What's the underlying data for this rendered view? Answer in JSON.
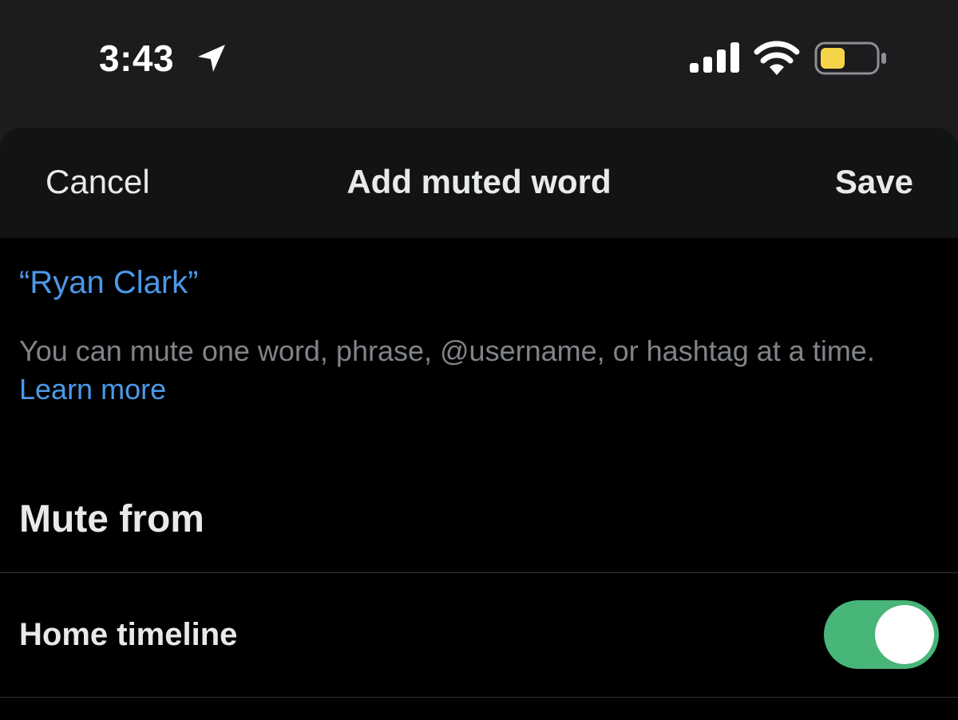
{
  "status_bar": {
    "time": "3:43",
    "location_icon": "location-arrow-icon",
    "signal_icon": "cellular-signal-icon",
    "wifi_icon": "wifi-icon",
    "battery_icon": "battery-low-power-icon",
    "battery_color": "#f5d547"
  },
  "sheet": {
    "cancel_label": "Cancel",
    "title": "Add muted word",
    "save_label": "Save",
    "word_value": "“Ryan Clark”",
    "help_text": "You can mute one word, phrase, @username, or hashtag at a time.",
    "learn_more_label": "Learn more",
    "mute_from_heading": "Mute from",
    "options": [
      {
        "label": "Home timeline",
        "enabled": true
      }
    ]
  },
  "colors": {
    "accent_blue": "#4a99e9",
    "toggle_on": "#48b579"
  }
}
